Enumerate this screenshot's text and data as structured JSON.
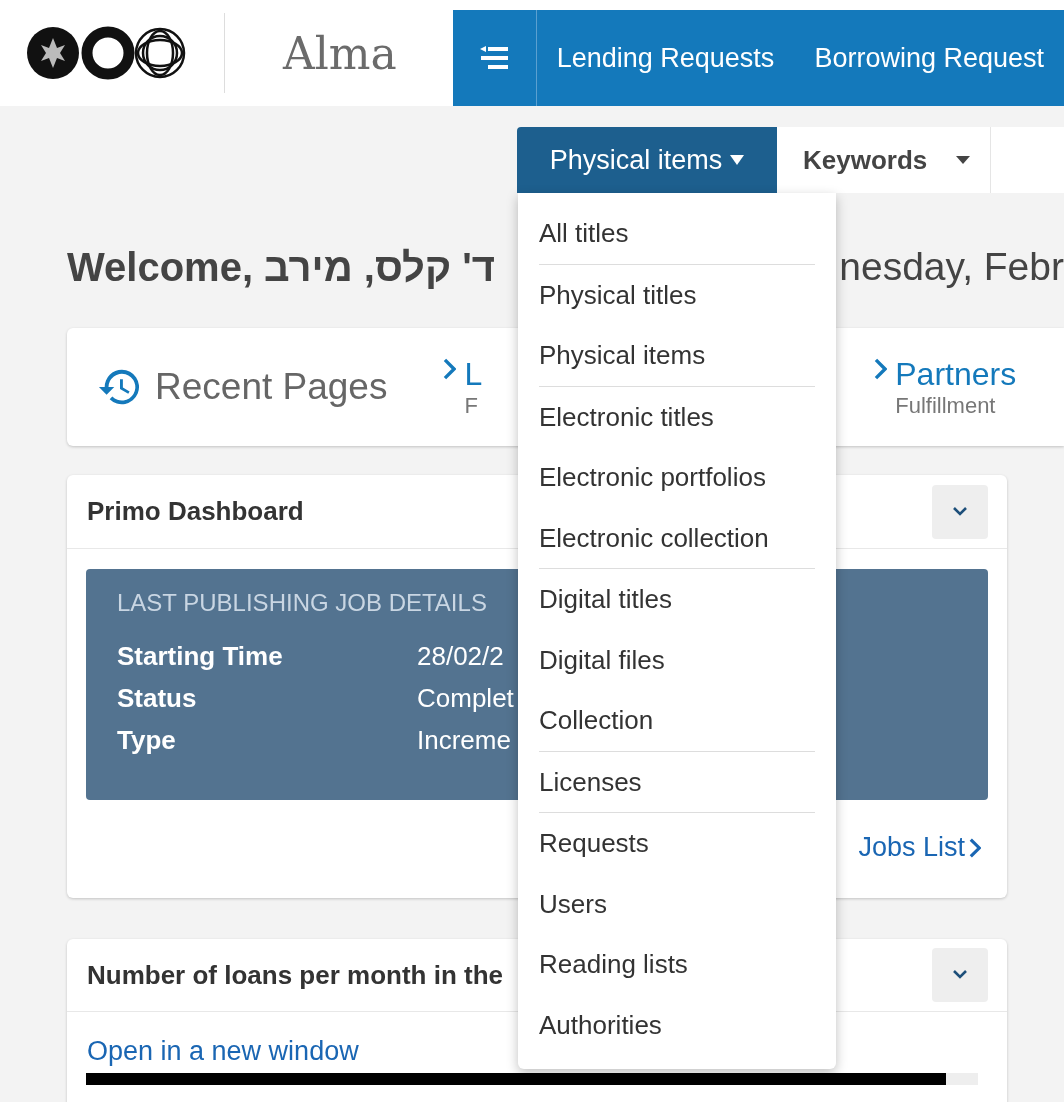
{
  "header": {
    "app_name": "Alma",
    "nav": [
      "Lending Requests",
      "Borrowing Request"
    ]
  },
  "search": {
    "scope": "Physical items",
    "field": "Keywords"
  },
  "scope_menu": {
    "groups": [
      [
        "All titles"
      ],
      [
        "Physical titles",
        "Physical items"
      ],
      [
        "Electronic titles",
        "Electronic portfolios",
        "Electronic collection"
      ],
      [
        "Digital titles",
        "Digital files",
        "Collection"
      ],
      [
        "Licenses"
      ],
      [
        "Requests",
        "Users",
        "Reading lists",
        "Authorities"
      ]
    ]
  },
  "welcome": {
    "greeting": "Welcome, ד' קלס, מירב",
    "date": "nesday, Febr"
  },
  "recent_pages": {
    "title": "Recent Pages",
    "links": [
      {
        "name": "L",
        "area": "F"
      },
      {
        "name": "Partners",
        "area": "Fulfillment"
      }
    ]
  },
  "primo_dashboard": {
    "title": "Primo Dashboard",
    "job": {
      "heading": "LAST PUBLISHING JOB DETAILS",
      "rows": [
        {
          "label": "Starting Time",
          "value": "28/02/2"
        },
        {
          "label": "Status",
          "value": "Complet"
        },
        {
          "label": "Type",
          "value": "Increme"
        }
      ]
    },
    "link": "Jobs List"
  },
  "loans_widget": {
    "title": "Number of loans per month in the",
    "link": "Open in a new window"
  }
}
